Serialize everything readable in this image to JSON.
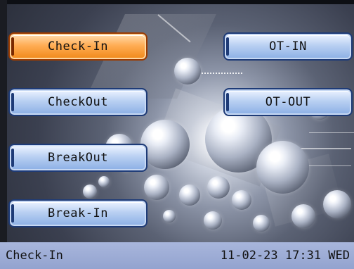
{
  "buttons": {
    "check_in": "Check-In",
    "check_out": "CheckOut",
    "break_out": "BreakOut",
    "break_in": "Break-In",
    "ot_in": "OT-IN",
    "ot_out": "OT-OUT"
  },
  "status_bar": {
    "mode": "Check-In",
    "datetime": "11-02-23 17:31 WED"
  },
  "colors": {
    "active_button": "#f28c1e",
    "button": "#8fb2e6",
    "status_bar": "#a8b6dc"
  }
}
